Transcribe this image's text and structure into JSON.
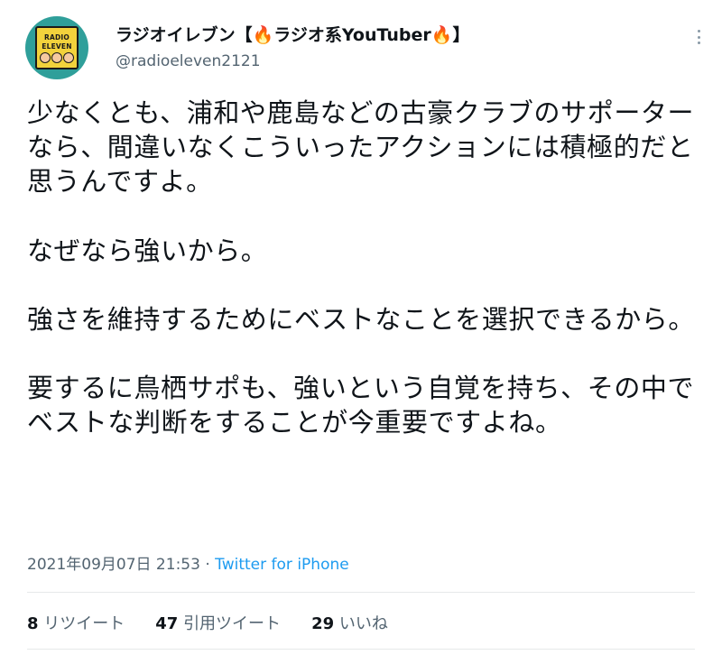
{
  "author": {
    "name_prefix": "ラジオイレブン【",
    "fire_1": "🔥",
    "name_middle": "ラジオ系YouTuber",
    "fire_2": "🔥",
    "name_suffix": "】",
    "handle": "@radioeleven2121",
    "avatar_line1": "RADIO",
    "avatar_line2": "ELEVEN"
  },
  "tweet": {
    "lines": [
      "少なくとも、浦和や鹿島などの古豪クラブのサポーターなら、間違いなくこういったアクションには積極的だと思うんですよ。",
      "なぜなら強いから。",
      "強さを維持するためにベストなことを選択できるから。",
      "要するに鳥栖サポも、強いという自覚を持ち、その中でベストな判断をすることが今重要ですよね。"
    ]
  },
  "meta": {
    "timestamp": "2021年09月07日 21:53",
    "separator": " · ",
    "source": "Twitter for iPhone"
  },
  "stats": {
    "retweets_count": "8",
    "retweets_label": "リツイート",
    "quotes_count": "47",
    "quotes_label": "引用ツイート",
    "likes_count": "29",
    "likes_label": "いいね"
  },
  "colors": {
    "text": "#0f1419",
    "secondary": "#536471",
    "link": "#1d9bf0",
    "avatar_bg": "#2f9f9a",
    "avatar_badge": "#f2d23c"
  }
}
